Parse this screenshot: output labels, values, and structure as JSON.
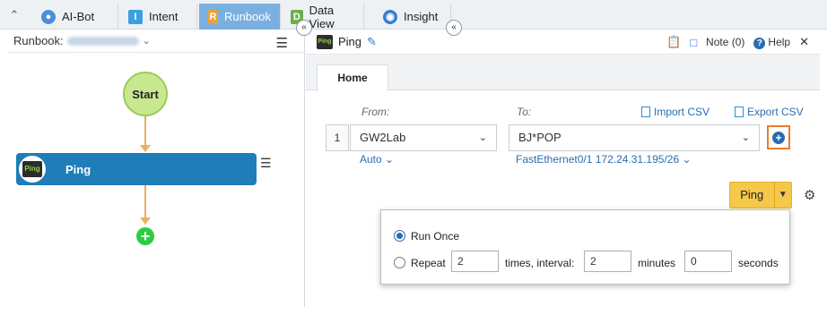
{
  "tabs": [
    {
      "label": "AI-Bot",
      "icon": "robot-icon"
    },
    {
      "label": "Intent",
      "icon": "intent-icon"
    },
    {
      "label": "Runbook",
      "icon": "runbook-icon",
      "active": true
    },
    {
      "label": "Data View",
      "icon": "dataview-icon"
    },
    {
      "label": "Insight",
      "icon": "insight-icon"
    }
  ],
  "left": {
    "header_label": "Runbook:",
    "flow": {
      "start_label": "Start",
      "ping_label": "Ping",
      "ping_icon_text": "Ping"
    }
  },
  "right": {
    "title": "Ping",
    "title_icon_text": "Ping",
    "note_label": "Note (0)",
    "help_label": "Help",
    "home_tab": "Home",
    "from_label": "From:",
    "to_label": "To:",
    "import_csv": "Import CSV",
    "export_csv": "Export CSV",
    "row_number": "1",
    "from_value": "GW2Lab",
    "to_value": "BJ*POP",
    "from_interface": "Auto",
    "to_interface": "FastEthernet0/1 172.24.31.195/26",
    "ping_button": "Ping",
    "run_options": {
      "run_once": "Run Once",
      "repeat": "Repeat",
      "repeat_count": "2",
      "times_interval": "times, interval:",
      "interval_minutes": "2",
      "minutes": "minutes",
      "interval_seconds": "0",
      "seconds": "seconds"
    }
  },
  "colors": {
    "active_tab": "#7ab0e0",
    "ping_node": "#1f7db8",
    "start_node": "#c8e88f",
    "connector": "#e8b060",
    "add_node": "#2ecc40",
    "ping_button": "#f5c84a",
    "highlight": "#f07a2a"
  }
}
